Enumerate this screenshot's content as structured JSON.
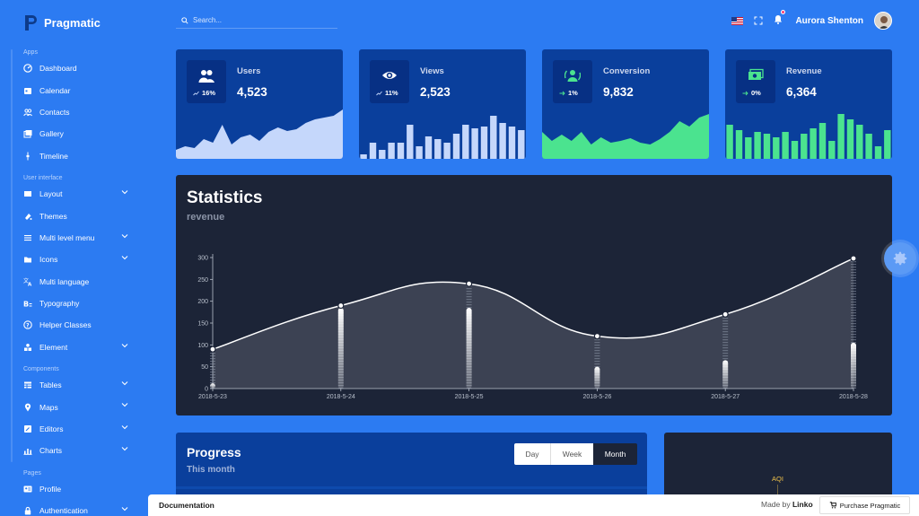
{
  "brand": {
    "name": "Pragmatic"
  },
  "search": {
    "placeholder": "Search..."
  },
  "user": {
    "name": "Aurora Shenton"
  },
  "sidebar": {
    "sections": [
      {
        "title": "Apps",
        "items": [
          {
            "label": "Dashboard",
            "icon": "dashboard-icon"
          },
          {
            "label": "Calendar",
            "icon": "calendar-icon"
          },
          {
            "label": "Contacts",
            "icon": "contacts-icon"
          },
          {
            "label": "Gallery",
            "icon": "gallery-icon"
          },
          {
            "label": "Timeline",
            "icon": "timeline-icon"
          }
        ]
      },
      {
        "title": "User interface",
        "items": [
          {
            "label": "Layout",
            "icon": "layout-icon",
            "expandable": true
          },
          {
            "label": "Themes",
            "icon": "themes-icon"
          },
          {
            "label": "Multi level menu",
            "icon": "menu-icon",
            "expandable": true
          },
          {
            "label": "Icons",
            "icon": "folder-icon",
            "expandable": true
          },
          {
            "label": "Multi language",
            "icon": "translate-icon"
          },
          {
            "label": "Typography",
            "icon": "typography-icon"
          },
          {
            "label": "Helper Classes",
            "icon": "help-icon"
          },
          {
            "label": "Element",
            "icon": "element-icon",
            "expandable": true
          }
        ]
      },
      {
        "title": "Components",
        "items": [
          {
            "label": "Tables",
            "icon": "table-icon",
            "expandable": true
          },
          {
            "label": "Maps",
            "icon": "map-pin-icon",
            "expandable": true
          },
          {
            "label": "Editors",
            "icon": "editor-icon",
            "expandable": true
          },
          {
            "label": "Charts",
            "icon": "chart-icon",
            "expandable": true
          }
        ]
      },
      {
        "title": "Pages",
        "items": [
          {
            "label": "Profile",
            "icon": "profile-icon"
          },
          {
            "label": "Authentication",
            "icon": "lock-icon",
            "expandable": true
          }
        ]
      }
    ]
  },
  "cards": [
    {
      "label": "Users",
      "value": "4,523",
      "change": "16%",
      "icon": "users-icon",
      "trend": "up",
      "spark_type": "area",
      "spark_color": "#c5d7fb",
      "spark": [
        10,
        14,
        12,
        22,
        18,
        38,
        16,
        24,
        27,
        20,
        30,
        35,
        31,
        33,
        40,
        44,
        46,
        48,
        55
      ]
    },
    {
      "label": "Views",
      "value": "2,523",
      "change": "11%",
      "icon": "eye-icon",
      "trend": "up",
      "spark_type": "bar",
      "spark_color": "#c5d7fb",
      "spark": [
        5,
        18,
        10,
        18,
        18,
        38,
        14,
        25,
        22,
        18,
        28,
        38,
        34,
        36,
        48,
        40,
        36,
        32
      ]
    },
    {
      "label": "Conversion",
      "value": "9,832",
      "change": "1%",
      "icon": "conversion-icon",
      "trend": "flat",
      "spark_type": "area",
      "spark_color": "#4be38f",
      "spark": [
        30,
        20,
        27,
        20,
        30,
        16,
        24,
        18,
        20,
        23,
        18,
        16,
        22,
        30,
        42,
        36,
        46,
        50
      ]
    },
    {
      "label": "Revenue",
      "value": "6,364",
      "change": "0%",
      "icon": "money-icon",
      "trend": "flat",
      "spark_type": "bar",
      "spark_color": "#4be38f",
      "spark": [
        38,
        32,
        24,
        30,
        28,
        24,
        30,
        20,
        28,
        34,
        40,
        20,
        50,
        44,
        38,
        28,
        14,
        32
      ]
    }
  ],
  "statistics": {
    "title": "Statistics",
    "subtitle": "revenue",
    "chart_data": {
      "type": "line",
      "categories": [
        "2018-5-23",
        "2018-5-24",
        "2018-5-25",
        "2018-5-26",
        "2018-5-27",
        "2018-5-28"
      ],
      "series": [
        {
          "name": "",
          "type": "line",
          "values": [
            90,
            190,
            240,
            120,
            170,
            298
          ]
        },
        {
          "name": "",
          "type": "bar",
          "values": [
            12,
            185,
            185,
            50,
            65,
            105
          ]
        }
      ],
      "ylim": [
        0,
        300
      ],
      "yticks": [
        0,
        50,
        100,
        150,
        200,
        250,
        300
      ]
    }
  },
  "progress": {
    "title": "Progress",
    "subtitle": "This month",
    "tabs": [
      "Day",
      "Week",
      "Month"
    ],
    "active_tab": "Month"
  },
  "aqi": {
    "label": "AQI"
  },
  "footer": {
    "documentation": "Documentation",
    "made_by_prefix": "Made by",
    "made_by": "Linko",
    "purchase": "Purchase Pragmatic"
  }
}
